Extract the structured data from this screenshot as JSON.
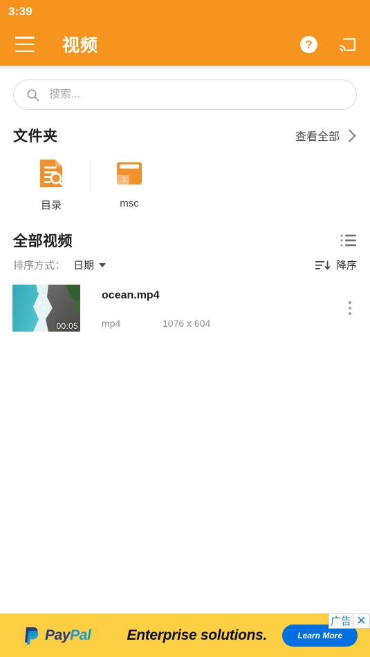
{
  "status_bar": {
    "time": "3:39"
  },
  "app_bar": {
    "title": "视频",
    "menu_icon": "hamburger-menu-icon",
    "help_icon": "help-question-icon",
    "help_glyph": "?",
    "cast_icon": "cast-screen-icon",
    "background_color": "#F7941E"
  },
  "search": {
    "placeholder": "搜索...",
    "value": "",
    "icon": "search-icon"
  },
  "folders_section": {
    "title": "文件夹",
    "see_all_label": "查看全部",
    "see_all_icon": "chevron-right-icon",
    "items": [
      {
        "label": "目录",
        "icon": "document-search-icon",
        "badge": ""
      },
      {
        "label": "msc",
        "icon": "folder-icon",
        "badge": "1"
      }
    ]
  },
  "videos_section": {
    "title": "全部视频",
    "view_toggle_icon": "list-view-icon",
    "sort_label": "排序方式：",
    "sort_value": "日期",
    "sort_dropdown_icon": "triangle-down-icon",
    "order_icon": "sort-descending-icon",
    "order_label": "降序",
    "items": [
      {
        "name": "ocean.mp4",
        "format": "mp4",
        "resolution": "1076 x 604",
        "duration": "00:05",
        "menu_icon": "overflow-menu-icon"
      }
    ]
  },
  "ad": {
    "brand_pay": "Pay",
    "brand_pal": "Pal",
    "headline": "Enterprise solutions.",
    "cta_label": "Learn More",
    "ad_label": "广告",
    "close_glyph": "✕",
    "background_color": "#FBCF41",
    "cta_color": "#0070E0"
  }
}
